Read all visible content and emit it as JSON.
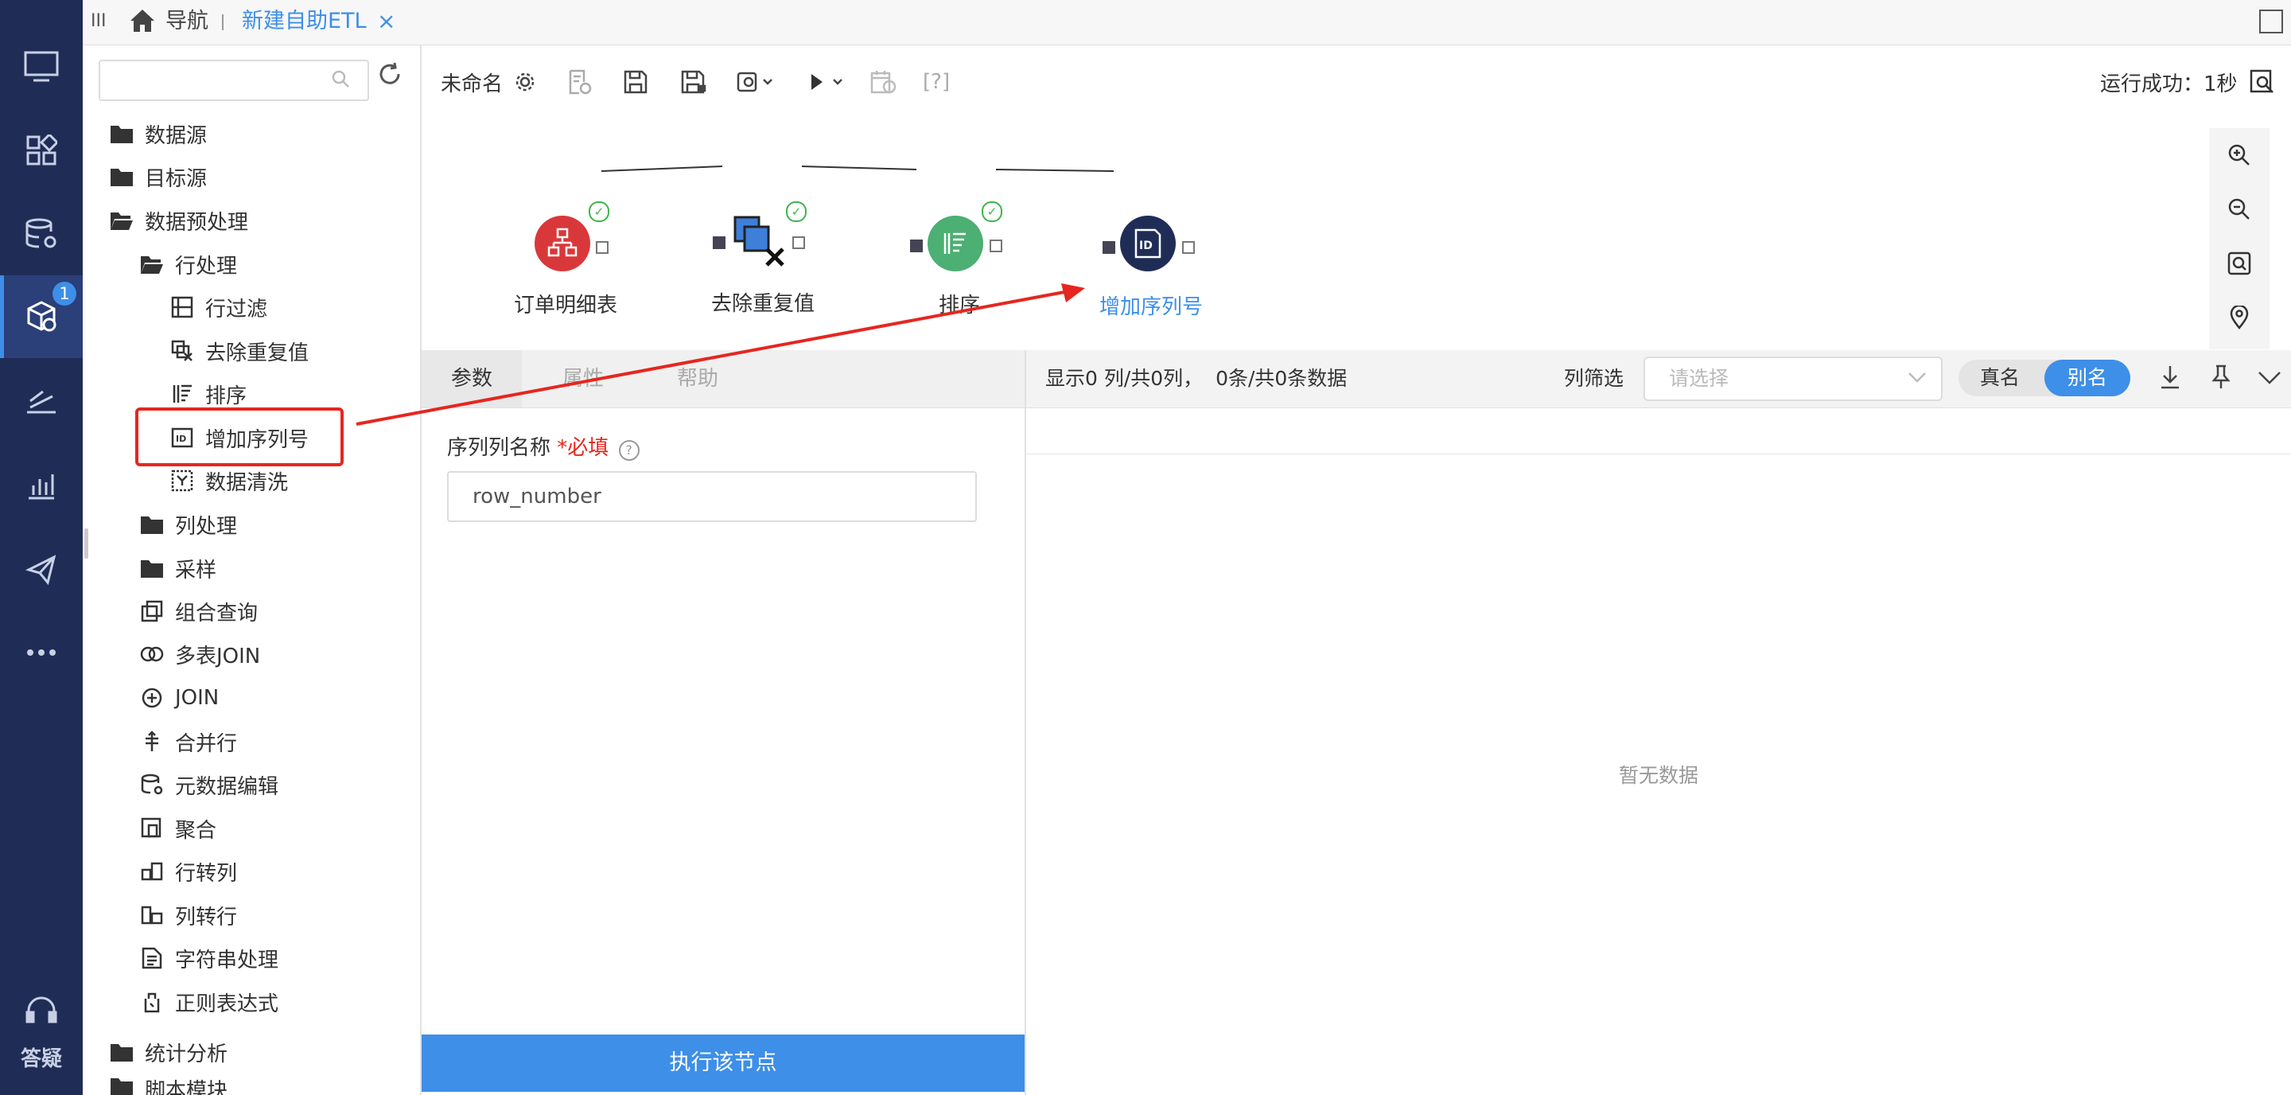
{
  "tabbar": {
    "home_label": "导航",
    "active_tab": "新建自助ETL",
    "close_glyph": "×",
    "menu_glyph": "III"
  },
  "nav": {
    "items": [
      "monitor-icon",
      "apps-icon",
      "database-settings-icon",
      "cube-etl-icon",
      "reports-icon",
      "chart-icon",
      "send-icon",
      "more-icon"
    ],
    "badge": "1",
    "help_label": "答疑"
  },
  "tree": {
    "search_placeholder": "",
    "items": [
      {
        "label": "数据源",
        "icon": "folder-icon"
      },
      {
        "label": "目标源",
        "icon": "folder-icon"
      },
      {
        "label": "数据预处理",
        "icon": "folder-open-icon"
      },
      {
        "label": "行处理",
        "icon": "folder-open-icon"
      },
      {
        "label": "行过滤",
        "icon": "row-filter-icon"
      },
      {
        "label": "去除重复值",
        "icon": "dedupe-icon"
      },
      {
        "label": "排序",
        "icon": "sort-icon"
      },
      {
        "label": "增加序列号",
        "icon": "id-serial-icon"
      },
      {
        "label": "数据清洗",
        "icon": "clean-icon"
      },
      {
        "label": "列处理",
        "icon": "folder-icon"
      },
      {
        "label": "采样",
        "icon": "folder-icon"
      },
      {
        "label": "组合查询",
        "icon": "combo-query-icon"
      },
      {
        "label": "多表JOIN",
        "icon": "multi-join-icon"
      },
      {
        "label": "JOIN",
        "icon": "join-icon"
      },
      {
        "label": "合并行",
        "icon": "merge-rows-icon"
      },
      {
        "label": "元数据编辑",
        "icon": "metadata-icon"
      },
      {
        "label": "聚合",
        "icon": "aggregate-icon"
      },
      {
        "label": "行转列",
        "icon": "row-to-col-icon"
      },
      {
        "label": "列转行",
        "icon": "col-to-row-icon"
      },
      {
        "label": "字符串处理",
        "icon": "string-icon"
      },
      {
        "label": "正则表达式",
        "icon": "regex-icon"
      },
      {
        "label": "统计分析",
        "icon": "folder-icon"
      },
      {
        "label": "脚本模块",
        "icon": "folder-icon"
      }
    ]
  },
  "canvas": {
    "name": "未命名",
    "run_status": "运行成功：1秒",
    "nodes": [
      {
        "label": "订单明细表",
        "color": "#d9383a",
        "done": true
      },
      {
        "label": "去除重复值",
        "color": "#3d7fd9",
        "done": true
      },
      {
        "label": "排序",
        "color": "#4caf73",
        "done": true
      },
      {
        "label": "增加序列号",
        "color": "#1f2d56",
        "done": false
      }
    ],
    "toolbar": [
      "settings-icon",
      "log-icon",
      "save-icon",
      "save-as-icon",
      "preview-icon",
      "run-icon",
      "schedule-icon",
      "help-icon"
    ],
    "help_text": "[?]"
  },
  "params": {
    "tabs": [
      "参数",
      "属性",
      "帮助"
    ],
    "field_label": "序列列名称",
    "required": "*必填",
    "help_glyph": "?",
    "field_value": "row_number",
    "run_button": "执行该节点"
  },
  "grid": {
    "summary": "显示0 列/共0列，  0条/共0条数据",
    "filter_label": "列筛选",
    "filter_placeholder": "请选择",
    "toggle": [
      "真名",
      "别名"
    ],
    "empty": "暂无数据"
  },
  "colors": {
    "nav_bg": "#1f2d56",
    "accent": "#3d8fe8",
    "annotation": "#e6261f"
  }
}
